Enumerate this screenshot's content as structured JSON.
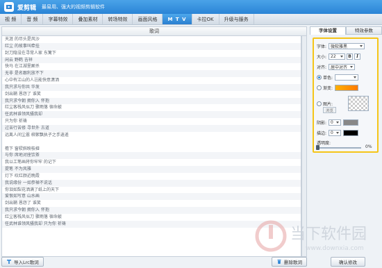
{
  "titlebar": {
    "app_name": "爱剪辑",
    "slogan": "最易用、强大的视频剪辑软件"
  },
  "tabs": [
    {
      "label": "视 频",
      "active": false
    },
    {
      "label": "音 频",
      "active": false
    },
    {
      "label": "字幕特效",
      "active": false
    },
    {
      "label": "叠加素材",
      "active": false
    },
    {
      "label": "转场特效",
      "active": false
    },
    {
      "label": "画面风格",
      "active": false
    },
    {
      "label": "M T V",
      "active": true
    },
    {
      "label": "卡拉OK",
      "active": false
    },
    {
      "label": "升级与服务",
      "active": false
    }
  ],
  "lyrics": {
    "header": "歌词",
    "rows": [
      "天涯 的尽头是风沙",
      "红尘 的故事叫牵挂",
      "封刀隐没在寻常人家 东篱下",
      "闲云 野鹤 吉祥",
      "快马 在江湖里厮杀",
      "无非 是名跟利放不下",
      "心中有江山的人岂能快意潇洒",
      "我只求与你共 华发",
      "剑出鞘 恩怨了 谁笑",
      "我只求今朝 拥你入 怀抱",
      "红尘客栈风似刀 骤雨落 宿命敲",
      "任武林谁领风骚我却 ",
      "只为你 祈祷",
      "过苦行苦修 寻世外 古道",
      "远离人间尘嚣 柳絮飘执子之手逍遥",
      "",
      "檐下 窗棂斜映枝桠",
      "与你 席地对座饮茶",
      "我以工笔画将你牢牢 的记下",
      "提笔 不为风雅",
      "灯下 叹红颜近晚霞",
      "我说缘份 一如参禅不说话",
      "你泪如梨花洒满了纸上的天下",
      "爱恨如写意 山水画",
      "剑出鞘 恩怨了 谁笑",
      "我只求今朝 拥你入 怀抱",
      "红尘客栈风似刀 骤雨落 宿命敲",
      "任武林谁领风骚我却 只为你 祈祷"
    ]
  },
  "buttons": {
    "import_lrc": "导入Lrc歌词",
    "delete_lyrics": "删除歌词",
    "confirm": "确认修改"
  },
  "right_tabs": [
    {
      "label": "字体设置",
      "active": true
    },
    {
      "label": "特效参数",
      "active": false
    }
  ],
  "font_settings": {
    "font_label": "字体:",
    "font_value": "微软雅黑",
    "size_label": "大小:",
    "size_value": "22",
    "bold": "B",
    "italic": "I",
    "align_label": "对齐:",
    "align_value": "居中对齐",
    "solid_label": "单色:",
    "gradient_label": "渐变:",
    "image_label": "图片:",
    "browse": "浏览",
    "shadow_label": "阴影:",
    "shadow_value": "0",
    "stroke_label": "描边:",
    "stroke_value": "0",
    "opacity_label": "透明度:",
    "opacity_value": "0%"
  },
  "colors": {
    "accent": "#2a84d6",
    "highlight": "#f5c518",
    "gradient_start": "#ffb000",
    "gradient_end": "#ff7a00"
  },
  "watermark": {
    "cn": "当下软件园",
    "en": "www.downxia.com"
  }
}
